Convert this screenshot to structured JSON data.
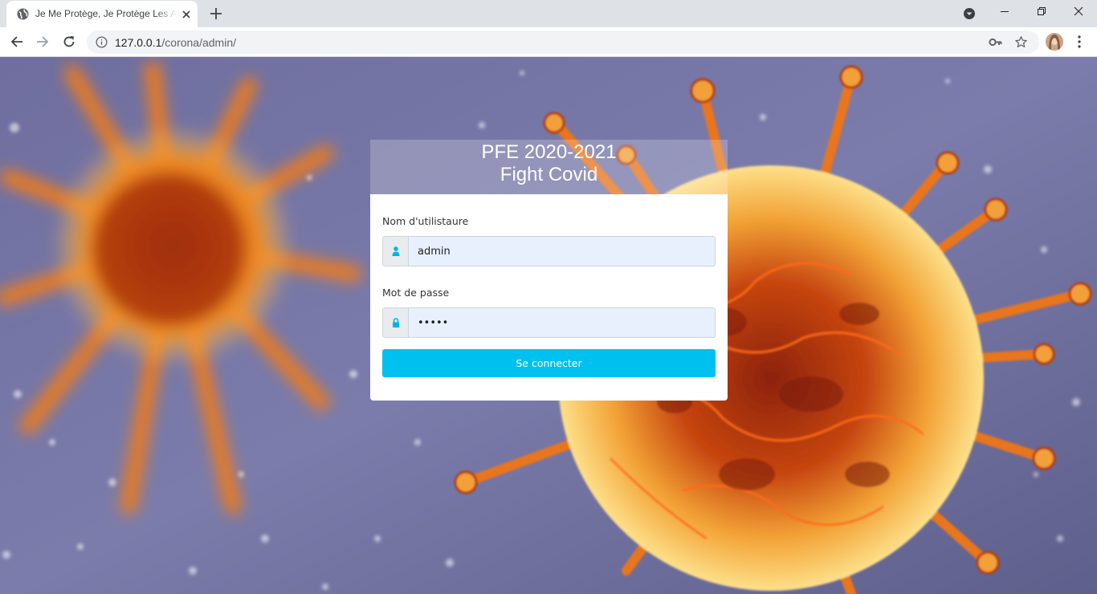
{
  "browser": {
    "tab_title": "Je Me Protège, Je Protège Les Autres",
    "url_host": "127.0.0.1",
    "url_path": "/corona/admin/"
  },
  "page": {
    "title_line1": "PFE 2020-2021",
    "title_line2": "Fight Covid",
    "username_label": "Nom d'utilistaure",
    "username_value": "admin",
    "password_label": "Mot de passe",
    "password_value": "•••••",
    "submit_label": "Se connecter"
  },
  "colors": {
    "accent": "#00c0ef",
    "input_bg": "#e8f0fe",
    "addon_icon": "#00b4e6"
  },
  "icons": {
    "username_addon": "user-icon",
    "password_addon": "lock-icon"
  }
}
